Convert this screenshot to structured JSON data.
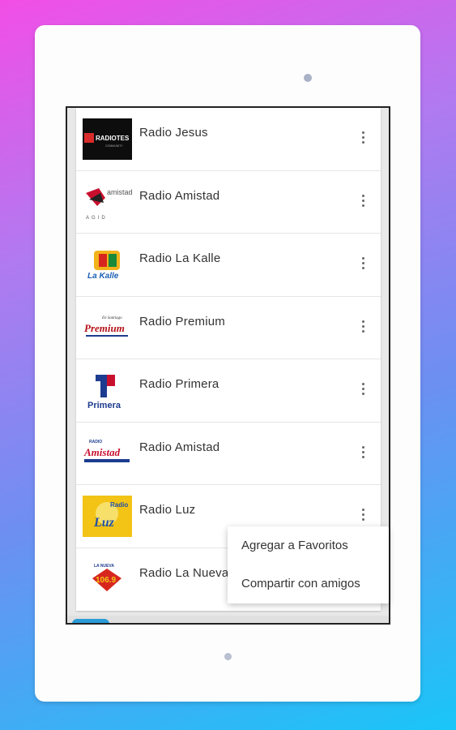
{
  "stations": [
    {
      "name": "Radio Jesus",
      "logo_text": "RADIOTES",
      "logo_sub": "COMMUNITY",
      "logo_colors": [
        "#0d0d0d",
        "#d92b2b"
      ]
    },
    {
      "name": "Radio Amistad",
      "logo_text": "amistad",
      "logo_sub": "AGID",
      "logo_colors": [
        "#ffffff",
        "#c8102e"
      ]
    },
    {
      "name": "Radio La Kalle",
      "logo_text": "La Kalle",
      "logo_sub": "",
      "logo_colors": [
        "#ffffff",
        "#1a5fb4"
      ]
    },
    {
      "name": "Radio Premium",
      "logo_text": "Premium",
      "logo_sub": "En Santiago",
      "logo_colors": [
        "#ffffff",
        "#b5121b"
      ]
    },
    {
      "name": "Radio Primera",
      "logo_text": "Primera",
      "logo_sub": "",
      "logo_colors": [
        "#ffffff",
        "#1d3c8f"
      ]
    },
    {
      "name": "Radio Amistad",
      "logo_text": "Amistad",
      "logo_sub": "RADIO",
      "logo_colors": [
        "#ffffff",
        "#c8102e"
      ]
    },
    {
      "name": "Radio Luz",
      "logo_text": "Luz",
      "logo_sub": "Radio",
      "logo_colors": [
        "#f3c316",
        "#2050a8"
      ]
    },
    {
      "name": "Radio La Nueva",
      "logo_text": "106.9",
      "logo_sub": "LA NUEVA",
      "logo_colors": [
        "#ffffff",
        "#d7261e"
      ]
    }
  ],
  "context_menu": {
    "items": [
      "Agregar a Favoritos",
      "Compartir con amigos"
    ]
  },
  "icons": {
    "more": "more-vert-icon"
  }
}
